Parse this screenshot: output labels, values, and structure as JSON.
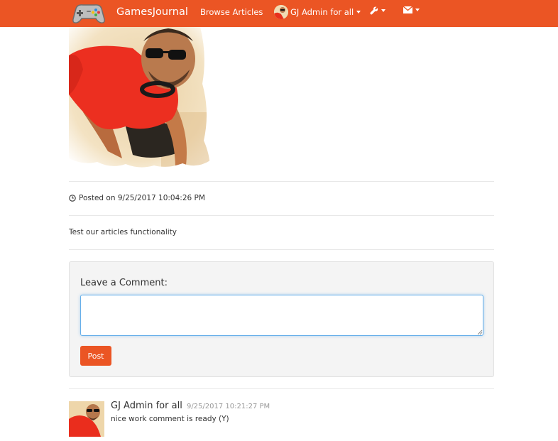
{
  "colors": {
    "brand": "#eb5524",
    "border": "#e8e8e8",
    "muted": "#999999",
    "focus": "#66afe9"
  },
  "navbar": {
    "logo_icon": "gamepad-icon",
    "brand": "GamesJournal",
    "browse_label": "Browse Articles",
    "user_label": "GJ Admin for all",
    "tools_icon": "wrench-icon",
    "mail_icon": "envelope-icon"
  },
  "article": {
    "posted_icon": "clock-icon",
    "posted_text": "Posted on 9/25/2017 10:04:26 PM",
    "body": "Test our articles functionality"
  },
  "comment_form": {
    "label": "Leave a Comment:",
    "value": "",
    "post_label": "Post"
  },
  "comments": [
    {
      "author": "GJ Admin for all",
      "time": "9/25/2017 10:21:27 PM",
      "text": "nice work comment is ready (Y)"
    }
  ]
}
